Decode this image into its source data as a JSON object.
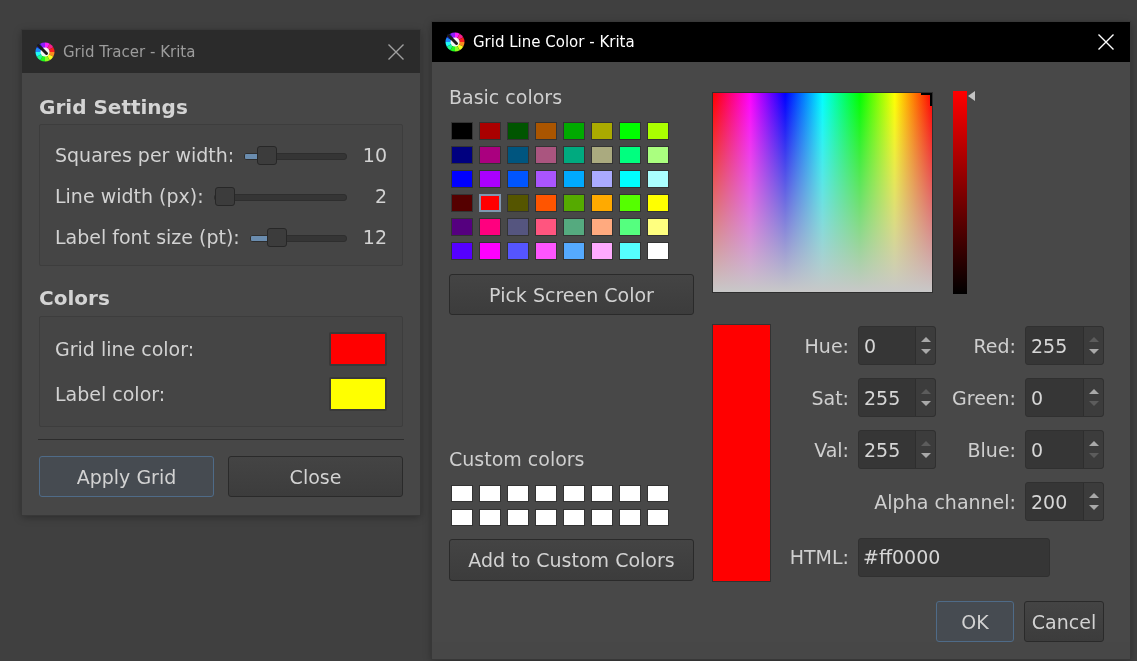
{
  "grid_tracer_dialog": {
    "title": "Grid Tracer - Krita",
    "focused": false,
    "sections": [
      {
        "heading": "Grid Settings",
        "rows": [
          {
            "kind": "slider",
            "label": "Squares per width:",
            "level": 0.15,
            "reading": "10"
          },
          {
            "kind": "slider",
            "label": "Line width (px):",
            "level": 0.01,
            "reading": "2"
          },
          {
            "kind": "slider",
            "label": "Label font size (pt):",
            "level": 0.22,
            "reading": "12"
          }
        ]
      },
      {
        "heading": "Colors",
        "rows": [
          {
            "kind": "color",
            "label": "Grid line color:",
            "color": "#ff0000"
          },
          {
            "kind": "color",
            "label": "Label color:",
            "color": "#ffff00"
          }
        ]
      }
    ],
    "buttons": [
      {
        "label": "Apply Grid",
        "focused": true
      },
      {
        "label": "Close",
        "focused": false
      }
    ]
  },
  "color_dialog": {
    "title": "Grid Line Color - Krita",
    "focused": true,
    "basic_colors": {
      "label": "Basic colors",
      "swatches": [
        {
          "color": "#000000",
          "selected": false
        },
        {
          "color": "#aa0000",
          "selected": false
        },
        {
          "color": "#005500",
          "selected": false
        },
        {
          "color": "#aa5500",
          "selected": false
        },
        {
          "color": "#00aa00",
          "selected": false
        },
        {
          "color": "#aaaa00",
          "selected": false
        },
        {
          "color": "#00ff00",
          "selected": false
        },
        {
          "color": "#aaff00",
          "selected": false
        },
        {
          "color": "#00007f",
          "selected": false
        },
        {
          "color": "#aa007f",
          "selected": false
        },
        {
          "color": "#00557f",
          "selected": false
        },
        {
          "color": "#aa557f",
          "selected": false
        },
        {
          "color": "#00aa7f",
          "selected": false
        },
        {
          "color": "#aaaa7f",
          "selected": false
        },
        {
          "color": "#00ff7f",
          "selected": false
        },
        {
          "color": "#aaff7f",
          "selected": false
        },
        {
          "color": "#0000ff",
          "selected": false
        },
        {
          "color": "#aa00ff",
          "selected": false
        },
        {
          "color": "#0055ff",
          "selected": false
        },
        {
          "color": "#aa55ff",
          "selected": false
        },
        {
          "color": "#00aaff",
          "selected": false
        },
        {
          "color": "#aaaaff",
          "selected": false
        },
        {
          "color": "#00ffff",
          "selected": false
        },
        {
          "color": "#aaffff",
          "selected": false
        },
        {
          "color": "#550000",
          "selected": false
        },
        {
          "color": "#ff0000",
          "selected": true
        },
        {
          "color": "#555500",
          "selected": false
        },
        {
          "color": "#ff5500",
          "selected": false
        },
        {
          "color": "#55aa00",
          "selected": false
        },
        {
          "color": "#ffaa00",
          "selected": false
        },
        {
          "color": "#55ff00",
          "selected": false
        },
        {
          "color": "#ffff00",
          "selected": false
        },
        {
          "color": "#55007f",
          "selected": false
        },
        {
          "color": "#ff007f",
          "selected": false
        },
        {
          "color": "#55557f",
          "selected": false
        },
        {
          "color": "#ff557f",
          "selected": false
        },
        {
          "color": "#55aa7f",
          "selected": false
        },
        {
          "color": "#ffaa7f",
          "selected": false
        },
        {
          "color": "#55ff7f",
          "selected": false
        },
        {
          "color": "#ffff7f",
          "selected": false
        },
        {
          "color": "#5500ff",
          "selected": false
        },
        {
          "color": "#ff00ff",
          "selected": false
        },
        {
          "color": "#5555ff",
          "selected": false
        },
        {
          "color": "#ff55ff",
          "selected": false
        },
        {
          "color": "#55aaff",
          "selected": false
        },
        {
          "color": "#ffaaff",
          "selected": false
        },
        {
          "color": "#55ffff",
          "selected": false
        },
        {
          "color": "#ffffff",
          "selected": false
        }
      ]
    },
    "pick_screen_button": {
      "label": "Pick Screen Color"
    },
    "custom_colors": {
      "label": "Custom colors",
      "swatches": [
        {
          "color": "#ffffff"
        },
        {
          "color": "#ffffff"
        },
        {
          "color": "#ffffff"
        },
        {
          "color": "#ffffff"
        },
        {
          "color": "#ffffff"
        },
        {
          "color": "#ffffff"
        },
        {
          "color": "#ffffff"
        },
        {
          "color": "#ffffff"
        },
        {
          "color": "#ffffff"
        },
        {
          "color": "#ffffff"
        },
        {
          "color": "#ffffff"
        },
        {
          "color": "#ffffff"
        },
        {
          "color": "#ffffff"
        },
        {
          "color": "#ffffff"
        },
        {
          "color": "#ffffff"
        },
        {
          "color": "#ffffff"
        }
      ]
    },
    "add_custom_button": {
      "label": "Add to Custom Colors"
    },
    "value_slider": {
      "level": 1
    },
    "current_color": {
      "color": "#ff0000"
    },
    "spin_fields": [
      {
        "label": "Hue:",
        "value": "0",
        "up_disabled": false,
        "down_disabled": false
      },
      {
        "label": "Red:",
        "value": "255",
        "up_disabled": true,
        "down_disabled": false
      },
      {
        "label": "Sat:",
        "value": "255",
        "up_disabled": true,
        "down_disabled": false
      },
      {
        "label": "Green:",
        "value": "0",
        "up_disabled": false,
        "down_disabled": true
      },
      {
        "label": "Val:",
        "value": "255",
        "up_disabled": true,
        "down_disabled": false
      },
      {
        "label": "Blue:",
        "value": "0",
        "up_disabled": false,
        "down_disabled": true
      },
      {
        "label": "Alpha channel:",
        "value": "200",
        "up_disabled": false,
        "down_disabled": false
      }
    ],
    "html_field": {
      "label": "HTML:",
      "value": "#ff0000"
    },
    "buttons": [
      {
        "label": "OK",
        "focused": true
      },
      {
        "label": "Cancel",
        "focused": false
      }
    ]
  }
}
